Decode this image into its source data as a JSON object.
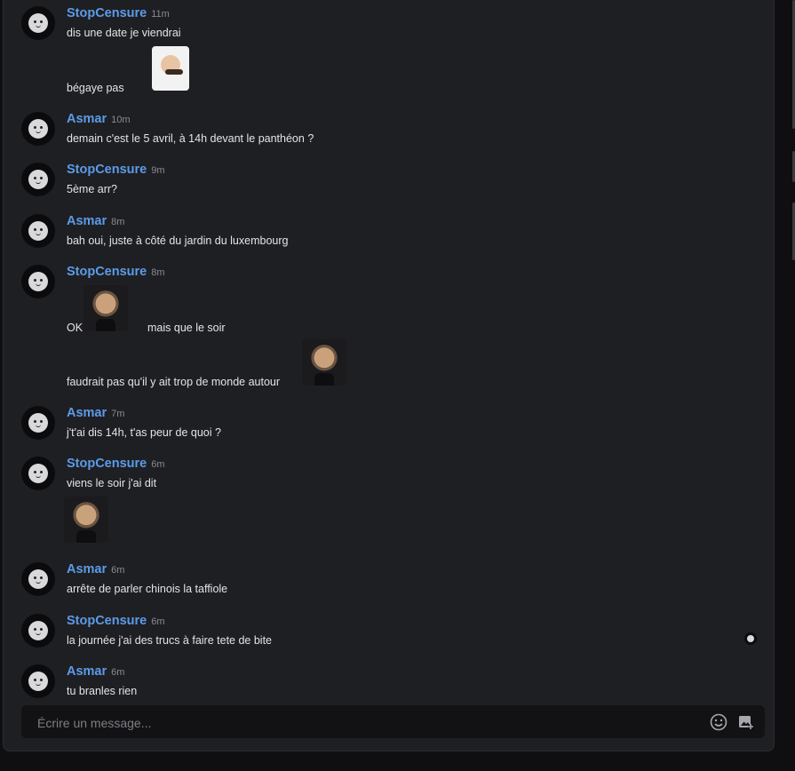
{
  "messages": [
    {
      "author": "StopCensure",
      "time": "11m",
      "lines": [
        "dis une date je viendrai",
        "bégaye pas"
      ]
    },
    {
      "author": "Asmar",
      "time": "10m",
      "lines": [
        "demain c'est le 5 avril, à 14h devant le panthéon ?"
      ]
    },
    {
      "author": "StopCensure",
      "time": "9m",
      "lines": [
        "5ème arr?"
      ]
    },
    {
      "author": "Asmar",
      "time": "8m",
      "lines": [
        "bah oui, juste à côté du jardin du luxembourg"
      ]
    },
    {
      "author": "StopCensure",
      "time": "8m",
      "lines": [
        "OK",
        "mais que le soir",
        "faudrait pas qu'il y ait trop de monde autour"
      ]
    },
    {
      "author": "Asmar",
      "time": "7m",
      "lines": [
        "j't'ai dis 14h, t'as peur de quoi ?"
      ]
    },
    {
      "author": "StopCensure",
      "time": "6m",
      "lines": [
        "viens le soir j'ai dit"
      ]
    },
    {
      "author": "Asmar",
      "time": "6m",
      "lines": [
        "arrête de parler chinois la taffiole"
      ]
    },
    {
      "author": "StopCensure",
      "time": "6m",
      "lines": [
        "la journée j'ai des trucs à faire tete de bite"
      ]
    },
    {
      "author": "Asmar",
      "time": "6m",
      "lines": [
        "tu branles rien"
      ]
    }
  ],
  "composer": {
    "placeholder": "Écrire un message...",
    "emoji_icon": "emoji-icon",
    "image_icon": "add-image-icon"
  },
  "colors": {
    "author": "#5d9be8",
    "panel": "#1e1f23",
    "composer": "#121215"
  }
}
